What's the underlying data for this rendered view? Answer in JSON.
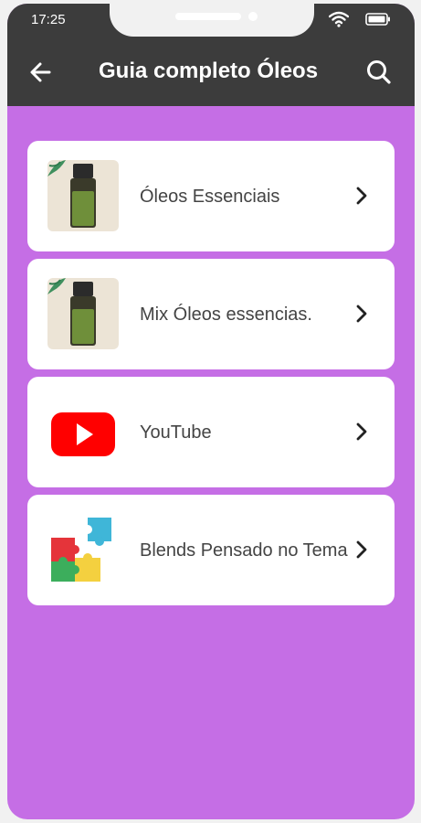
{
  "status_bar": {
    "time": "17:25",
    "icons": [
      "wifi-icon",
      "battery-icon"
    ]
  },
  "app_bar": {
    "title": "Guia completo Óleos",
    "back_icon": "arrow-left-icon",
    "search_icon": "search-icon",
    "background_color": "#3c3c3c"
  },
  "content": {
    "background_color": "#c56ee5",
    "items": [
      {
        "label": "Óleos Essenciais",
        "icon": "essential-oil-bottle-icon"
      },
      {
        "label": "Mix Óleos essencias.",
        "icon": "essential-oil-bottle-icon"
      },
      {
        "label": "YouTube",
        "icon": "youtube-icon"
      },
      {
        "label": "Blends Pensado no Tema",
        "icon": "puzzle-icon"
      }
    ]
  }
}
